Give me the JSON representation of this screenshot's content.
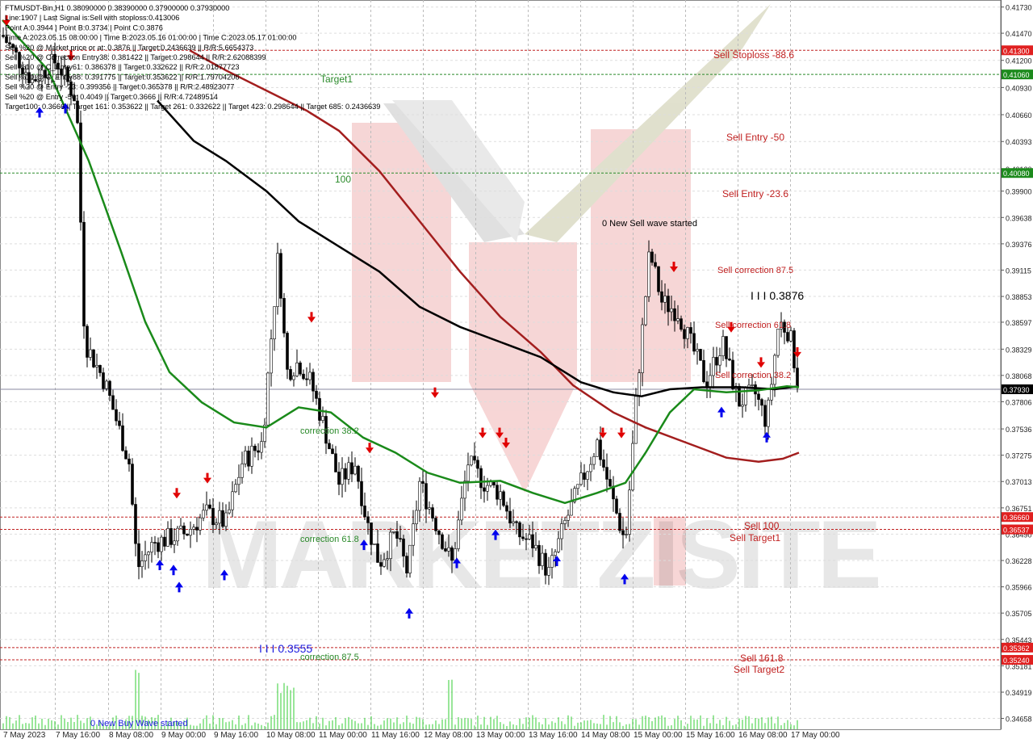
{
  "chart_data": {
    "type": "candlestick",
    "symbol": "FTMUSDT-Bin",
    "timeframe": "H1",
    "header_lines": [
      "FTMUSDT-Bin,H1  0.38090000  0.38390000  0.37900000  0.37930000",
      "Line:1907  | Last Signal is:Sell with stoploss:0.413006",
      "Point A:0.3944 | Point B:0.3734 | Point C:0.3876",
      "Time A:2023.05.15 08:00:00 | Time B:2023.05.16 01:00:00 | Time C:2023.05.17 01:00:00",
      "Sell %20 @ Market price or at: 0.3876 || Target:0.2436639 || R/R:5.6654373",
      "Sell %20 @ Correction Entry38: 0.381422 || Target:0.298644 || R/R:2.62088399",
      "Sell %10 @ C_Entry61: 0.386378 || Target:0.332622 || R/R:2.01877723",
      "Sell %10 @ C_Entry88: 0.391775 || Target:0.353622 || R/R:1.79704206",
      "Sell %20 @ Entry -23: 0.399356 || Target:0.365378 || R/R:2.48923077",
      "Sell %20 @ Entry -50: 0.4049 || Target:0.3666 || R/R:4.72489514",
      "Target100: 0.3666 || Target 161: 0.353622 || Target 261: 0.332622 || Target 423: 0.298644 || Target 685: 0.2436639"
    ],
    "y_ticks": [
      "0.41730",
      "0.41470",
      "0.41200",
      "0.40930",
      "0.40660",
      "0.40393",
      "0.40120",
      "0.39900",
      "0.39638",
      "0.39376",
      "0.39115",
      "0.38853",
      "0.38597",
      "0.38329",
      "0.38068",
      "0.37806",
      "0.37536",
      "0.37275",
      "0.37013",
      "0.36751",
      "0.36490",
      "0.36228",
      "0.35966",
      "0.35705",
      "0.35443",
      "0.35181",
      "0.34919",
      "0.34658"
    ],
    "x_ticks": [
      "7 May 2023",
      "7 May 16:00",
      "8 May 08:00",
      "9 May 00:00",
      "9 May 16:00",
      "10 May 08:00",
      "11 May 00:00",
      "11 May 16:00",
      "12 May 08:00",
      "13 May 00:00",
      "13 May 16:00",
      "14 May 08:00",
      "15 May 00:00",
      "15 May 16:00",
      "16 May 08:00",
      "17 May 00:00"
    ],
    "ylim": [
      0.3455,
      0.418
    ],
    "price_tags": [
      {
        "value": 0.413,
        "label": "0.41300",
        "color": "#e02020"
      },
      {
        "value": 0.4106,
        "label": "0.41060",
        "color": "#1c8a1c"
      },
      {
        "value": 0.4008,
        "label": "0.40080",
        "color": "#1c8a1c"
      },
      {
        "value": 0.3793,
        "label": "0.37930",
        "color": "#000000"
      },
      {
        "value": 0.3666,
        "label": "0.36660",
        "color": "#e02020"
      },
      {
        "value": 0.36537,
        "label": "0.36537",
        "color": "#e02020"
      },
      {
        "value": 0.35362,
        "label": "0.35362",
        "color": "#e02020"
      },
      {
        "value": 0.3524,
        "label": "0.35240",
        "color": "#e02020"
      }
    ],
    "annotations": {
      "sell_stoploss": "Sell Stoploss -88.6",
      "target1": "Target1",
      "sell_entry_50": "Sell Entry -50",
      "level_100": "100",
      "sell_entry_23": "Sell Entry -23.6",
      "new_sell_wave": "0 New Sell wave started",
      "sell_corr_875": "Sell correction 87.5",
      "sell_corr_618": "Sell correction 61.8",
      "sell_corr_382": "Sell correction 38.2",
      "point_c_label": "I I I 0.3876",
      "correction_382": "correction 38.2",
      "correction_618": "correction 61.8",
      "correction_875": "correction 87.5",
      "sell_100": "Sell 100",
      "sell_target1": "Sell Target1",
      "sell_1618": "Sell 161.8",
      "sell_target2": "Sell Target2",
      "point_b_label": "I I I 0.3555",
      "new_buy_wave": "0 New Buy Wave started"
    },
    "colors": {
      "ma_green": "#1a8a1a",
      "ma_black": "#000000",
      "ma_red": "#a31e1e",
      "sell_arrow": "#e00000",
      "buy_arrow": "#0000ee",
      "level_red": "#c02020",
      "level_green": "#2a8a2a"
    },
    "watermark": "MARKETZISITE"
  }
}
